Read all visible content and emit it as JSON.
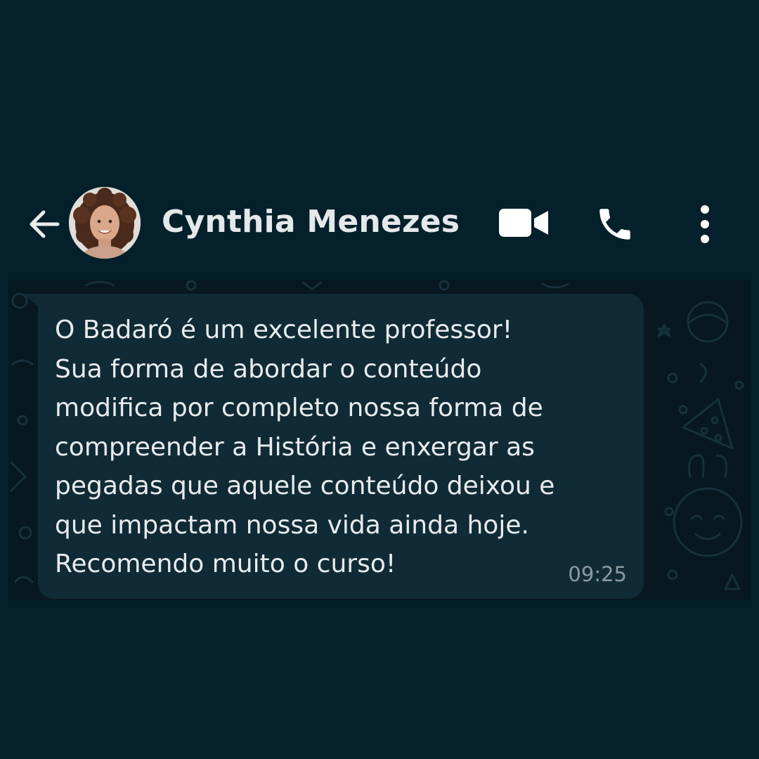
{
  "header": {
    "contact_name": "Cynthia Menezes",
    "back_icon": "arrow-left-icon",
    "video_icon": "video-camera-icon",
    "call_icon": "phone-icon",
    "menu_icon": "more-vertical-icon"
  },
  "message": {
    "lines": [
      "O Badaró é um excelente professor!",
      "Sua forma de abordar o conteúdo",
      "modifica por completo nossa forma de",
      "compreender a História e enxergar as",
      "pegadas que aquele conteúdo deixou e",
      "que impactam nossa vida ainda hoje.",
      "Recomendo muito o curso!"
    ],
    "time": "09:25"
  },
  "colors": {
    "background": "#04202b",
    "bubble": "#102b35",
    "text": "#e8ecee",
    "timestamp": "#8a9aa1"
  }
}
